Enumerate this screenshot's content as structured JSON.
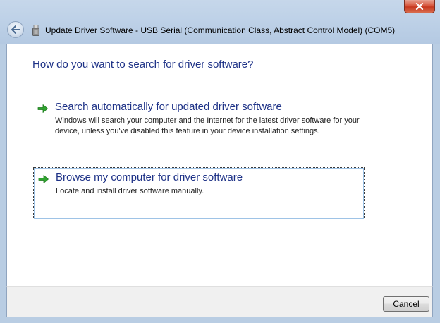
{
  "window": {
    "title": "Update Driver Software - USB Serial (Communication Class, Abstract Control Model) (COM5)",
    "close_glyph": "x"
  },
  "main": {
    "heading": "How do you want to search for driver software?",
    "options": [
      {
        "title": "Search automatically for updated driver software",
        "description": "Windows will search your computer and the Internet for the latest driver software for your device, unless you've disabled this feature in your device installation settings."
      },
      {
        "title": "Browse my computer for driver software",
        "description": "Locate and install driver software manually.",
        "focused": true
      }
    ]
  },
  "footer": {
    "cancel_label": "Cancel"
  },
  "icons": {
    "back": "back-arrow-icon",
    "device": "usb-device-icon",
    "option_arrow": "green-arrow-icon",
    "close": "close-icon"
  },
  "colors": {
    "heading_text": "#1e3287",
    "arrow_green": "#2fa32f",
    "close_red": "#c7381f",
    "frame": "#bfd2e8"
  }
}
